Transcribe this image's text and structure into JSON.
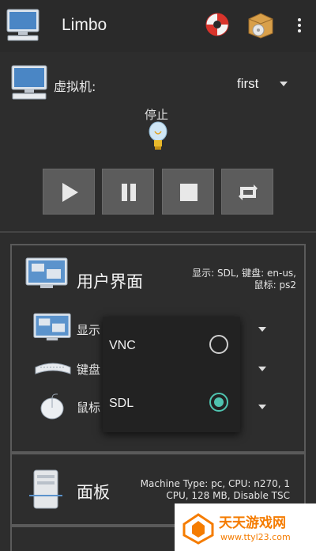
{
  "appbar": {
    "title": "Limbo",
    "icons": [
      "computer-icon",
      "lifebuoy-icon",
      "package-icon",
      "overflow-menu-icon"
    ]
  },
  "vm": {
    "label": "虚拟机:",
    "selected": "first"
  },
  "status": {
    "label": "停止"
  },
  "controls": [
    "play-icon",
    "pause-icon",
    "stop-icon",
    "restart-icon"
  ],
  "ui_section": {
    "title": "用户界面",
    "desc_line1": "显示: SDL, 键盘: en-us,",
    "desc_line2": "鼠标: ps2",
    "rows": [
      {
        "label": "显示"
      },
      {
        "label": "键盘"
      },
      {
        "label": "鼠标"
      }
    ]
  },
  "display_popup": {
    "options": [
      {
        "label": "VNC",
        "selected": false
      },
      {
        "label": "SDL",
        "selected": true
      }
    ]
  },
  "board_section": {
    "title": "面板",
    "desc_line1": "Machine Type: pc, CPU: n270, 1",
    "desc_line2": "CPU, 128 MB, Disable TSC"
  },
  "watermark": {
    "title": "天天游戏网",
    "url": "www.ttyl23.com"
  },
  "colors": {
    "background": "#2d2d2d",
    "button": "#5c5c5c",
    "accent": "#4fc3b0",
    "watermark": "#f57c00"
  }
}
